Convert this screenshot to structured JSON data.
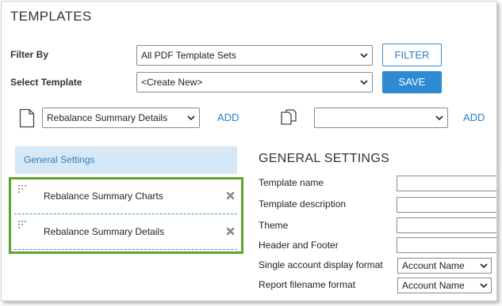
{
  "page": {
    "title": "TEMPLATES"
  },
  "filter": {
    "label": "Filter By",
    "selected": "All PDF Template Sets",
    "button": "FILTER"
  },
  "select_template": {
    "label": "Select Template",
    "selected": "<Create New>",
    "button": "SAVE"
  },
  "add_page": {
    "icon": "page-icon",
    "selected": "Rebalance Summary Details",
    "add_label": "ADD"
  },
  "add_copy": {
    "icon": "copy-icon",
    "selected": "",
    "add_label": "ADD"
  },
  "sidebar": {
    "header": "General Settings",
    "items": [
      {
        "label": "Rebalance Summary Charts"
      },
      {
        "label": "Rebalance Summary Details"
      }
    ]
  },
  "general_settings": {
    "title": "GENERAL SETTINGS",
    "fields": [
      {
        "label": "Template name",
        "value": ""
      },
      {
        "label": "Template description",
        "value": ""
      },
      {
        "label": "Theme",
        "value": ""
      },
      {
        "label": "Header and Footer",
        "value": ""
      },
      {
        "label": "Single account display format",
        "value": "Account Name"
      },
      {
        "label": "Report filename format",
        "value": "Account Name"
      }
    ]
  },
  "colors": {
    "accent": "#2d8ad3",
    "link": "#2d7fc1",
    "highlight_border": "#5fa32e",
    "sidebar_header_bg": "#d6e8f6"
  }
}
